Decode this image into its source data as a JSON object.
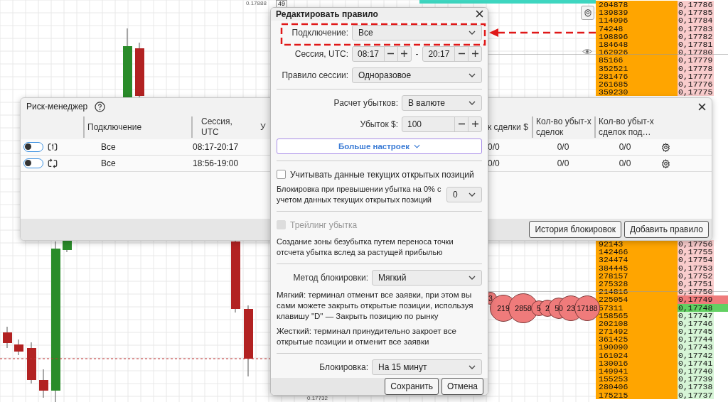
{
  "chart_labels": {
    "top_price": "0.17888",
    "top_badge": "49",
    "bottom_price": "0.17732"
  },
  "order_book": {
    "upper": [
      {
        "volume": "204878",
        "price": "0,17786",
        "kind": "ask"
      },
      {
        "volume": "139839",
        "price": "0,17785",
        "kind": "ask"
      },
      {
        "volume": "114096",
        "price": "0,17784",
        "kind": "ask"
      },
      {
        "volume": "74248",
        "price": "0,17783",
        "kind": "ask"
      },
      {
        "volume": "198896",
        "price": "0,17782",
        "kind": "ask"
      },
      {
        "volume": "184648",
        "price": "0,17781",
        "kind": "ask"
      },
      {
        "volume": "162926",
        "price": "0,17780",
        "kind": "ask"
      },
      {
        "volume": "85166",
        "price": "0,17779",
        "kind": "ask"
      },
      {
        "volume": "352521",
        "price": "0,17778",
        "kind": "ask"
      },
      {
        "volume": "281476",
        "price": "0,17777",
        "kind": "ask"
      },
      {
        "volume": "261685",
        "price": "0,17776",
        "kind": "ask"
      },
      {
        "volume": "359230",
        "price": "0,17775",
        "kind": "ask"
      }
    ],
    "lower": [
      {
        "volume": "92143",
        "price": "0,17756",
        "kind": "ask"
      },
      {
        "volume": "142466",
        "price": "0,17755",
        "kind": "ask"
      },
      {
        "volume": "324474",
        "price": "0,17754",
        "kind": "ask"
      },
      {
        "volume": "384445",
        "price": "0,17753",
        "kind": "ask"
      },
      {
        "volume": "278157",
        "price": "0,17752",
        "kind": "ask"
      },
      {
        "volume": "275328",
        "price": "0,17751",
        "kind": "ask"
      },
      {
        "volume": "214816",
        "price": "0,17750",
        "kind": "ask"
      },
      {
        "volume": "225054",
        "price": "0,17749",
        "kind": "best_ask"
      },
      {
        "volume": "57311",
        "price": "0,17748",
        "kind": "best_bid"
      },
      {
        "volume": "158565",
        "price": "0,17747",
        "kind": "bid"
      },
      {
        "volume": "202108",
        "price": "0,17746",
        "kind": "bid"
      },
      {
        "volume": "271492",
        "price": "0,17745",
        "kind": "bid"
      },
      {
        "volume": "361425",
        "price": "0,17744",
        "kind": "bid"
      },
      {
        "volume": "190090",
        "price": "0,17743",
        "kind": "bid"
      },
      {
        "volume": "161024",
        "price": "0,17742",
        "kind": "bid"
      },
      {
        "volume": "130016",
        "price": "0,17741",
        "kind": "bid"
      },
      {
        "volume": "149941",
        "price": "0,17740",
        "kind": "bid"
      },
      {
        "volume": "155253",
        "price": "0,17739",
        "kind": "bid"
      },
      {
        "volume": "280406",
        "price": "0,17738",
        "kind": "bid"
      },
      {
        "volume": "175215",
        "price": "0,17737",
        "kind": "bid"
      }
    ]
  },
  "trade_bubbles": [
    {
      "label": "3"
    },
    {
      "label": "219"
    },
    {
      "label": "2858"
    },
    {
      "label": "5"
    },
    {
      "label": "2"
    },
    {
      "label": "50"
    },
    {
      "label": "23"
    },
    {
      "label": "17188"
    }
  ],
  "risk_manager": {
    "title": "Риск-менеджер",
    "columns": [
      "Подключение",
      "Сессия, UTC",
      "У",
      "к сделки $",
      "Кол-во убыт-х сделок",
      "Кол-во убыт-х сделок под…"
    ],
    "rows": [
      {
        "on": false,
        "kind": "once",
        "connection": "Все",
        "session": "08:17-20:17",
        "cells": [
          "0/0",
          "0/0",
          "0/0"
        ]
      },
      {
        "on": false,
        "kind": "repeat",
        "connection": "Все",
        "session": "18:56-19:00",
        "cells": [
          "0/0",
          "0/0",
          "0/0"
        ]
      }
    ],
    "buttons": [
      "История блокировок",
      "Добавить правило"
    ]
  },
  "edit_rule_dialog": {
    "title": "Редактировать правило",
    "connection": {
      "label": "Подключение:",
      "value": "Все"
    },
    "session": {
      "label": "Сессия, UTC:",
      "from": "08:17",
      "separator": "-",
      "to": "20:17"
    },
    "session_rule": {
      "label": "Правило сессии:",
      "value": "Одноразовое"
    },
    "loss_calc": {
      "label": "Расчет убытков:",
      "value": "В валюте"
    },
    "loss": {
      "label": "Убыток $:",
      "value": "100"
    },
    "more_button": "Больше настроек",
    "open_positions": {
      "label": "Учитывать данные текущих открытых позиций",
      "checked": false,
      "disabled": false
    },
    "block_threshold": {
      "text": "Блокировка при превышении убытка на 0% с учетом данных текущих открытых позиций",
      "value": "0"
    },
    "trailing": {
      "label": "Трейлинг убытка",
      "checked": false,
      "disabled": true
    },
    "trailing_description": "Создание зоны безубытка путем переноса точки отсчета убытка вслед за растущей прибылью",
    "block_method": {
      "label": "Метод блокировки:",
      "value": "Мягкий"
    },
    "method_notes": [
      "Мягкий: терминал отменит все заявки, при этом вы сами можете закрыть открытые позиции, используя клавишу \"D\" — Закрыть позицию по рынку",
      "Жесткий: терминал принудительно закроет все открытые позиции и отменит все заявки"
    ],
    "block_duration": {
      "label": "Блокировка:",
      "value": "На 15 минут"
    },
    "buttons": [
      "Сохранить",
      "Отмена"
    ]
  }
}
